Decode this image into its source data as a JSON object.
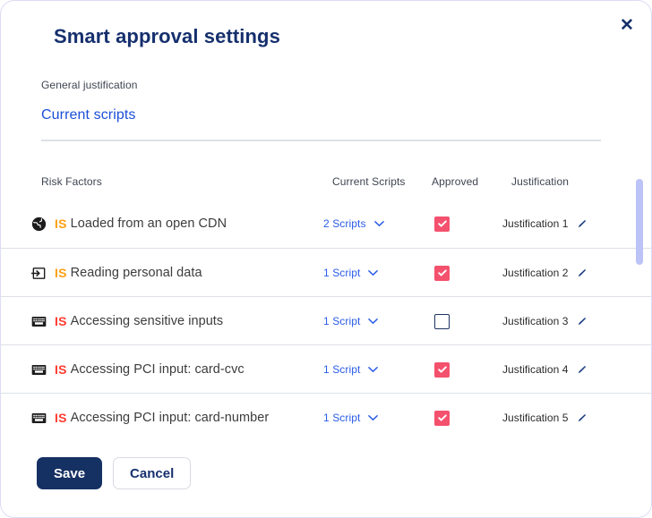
{
  "modal": {
    "title": "Smart approval settings",
    "close_icon": "close-icon",
    "close_label": "✕"
  },
  "general_justification": {
    "label": "General justification",
    "value": "Current scripts"
  },
  "table": {
    "headers": {
      "risk_factors": "Risk Factors",
      "current_scripts": "Current Scripts",
      "approved": "Approved",
      "justification": "Justification"
    },
    "rows": [
      {
        "icon": "globe-icon",
        "severity_badge": "IS",
        "severity": "medium",
        "risk_text": "Loaded from an open CDN",
        "scripts_label": "2 Scripts",
        "approved": true,
        "justification": "Justification 1"
      },
      {
        "icon": "input-arrow-icon",
        "severity_badge": "IS",
        "severity": "medium",
        "risk_text": "Reading personal data",
        "scripts_label": "1 Script",
        "approved": true,
        "justification": "Justification 2"
      },
      {
        "icon": "keyboard-icon",
        "severity_badge": "IS",
        "severity": "high",
        "risk_text": "Accessing sensitive inputs",
        "scripts_label": "1 Script",
        "approved": false,
        "justification": "Justification 3"
      },
      {
        "icon": "keyboard-icon",
        "severity_badge": "IS",
        "severity": "high",
        "risk_text": "Accessing PCI input: card-cvc",
        "scripts_label": "1 Script",
        "approved": true,
        "justification": "Justification 4"
      },
      {
        "icon": "keyboard-icon",
        "severity_badge": "IS",
        "severity": "high",
        "risk_text": "Accessing PCI input: card-number",
        "scripts_label": "1 Script",
        "approved": true,
        "justification": "Justification 5"
      }
    ]
  },
  "footer": {
    "save_label": "Save",
    "cancel_label": "Cancel"
  },
  "colors": {
    "title_navy": "#16306e",
    "link_blue": "#2a5ce8",
    "severity_high": "#ff3b30",
    "severity_medium": "#ffa012",
    "checkbox_pink": "#f4516e",
    "save_navy": "#153163",
    "scrollbar": "#bcc3f7",
    "divider": "#dde0e6"
  }
}
